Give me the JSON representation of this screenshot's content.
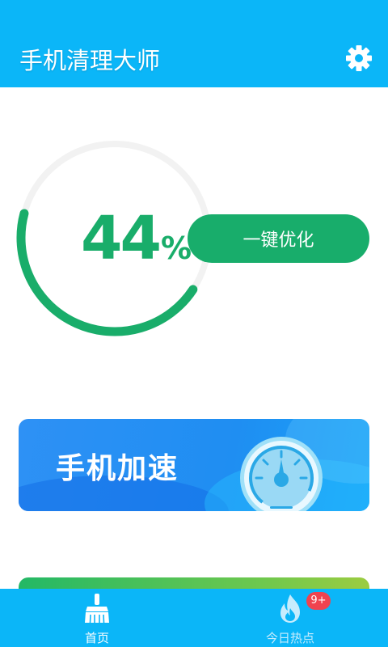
{
  "header": {
    "title": "手机清理大师",
    "settings_icon": "gear-icon"
  },
  "memory": {
    "value": "44",
    "unit": "%",
    "usage_fraction": 0.44,
    "color": "#19ad6a"
  },
  "optimize_button": {
    "label": "一键优化"
  },
  "speed_card": {
    "title": "手机加速",
    "icon": "speedometer-icon"
  },
  "bottom_nav": {
    "items": [
      {
        "label": "首页",
        "icon": "broom-icon",
        "selected": true
      },
      {
        "label": "今日热点",
        "icon": "flame-icon",
        "selected": false,
        "badge": "9+"
      }
    ]
  },
  "colors": {
    "primary": "#0bb6f8",
    "accent_green": "#18ad6b",
    "badge_red": "#f0434f"
  }
}
